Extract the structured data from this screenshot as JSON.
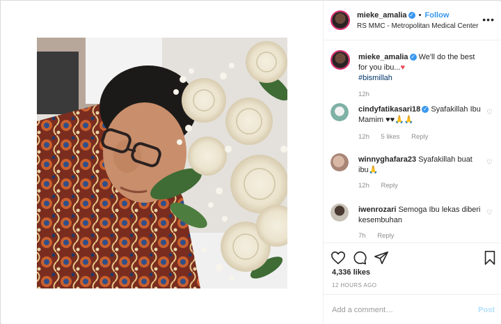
{
  "header": {
    "username": "mieke_amalia",
    "follow_label": "Follow",
    "dot": "•",
    "location": "RS MMC - Metropolitan Medical Center",
    "more_label": "•••"
  },
  "caption": {
    "username": "mieke_amalia",
    "text": "We'll do the best for you ibu...",
    "heart": "♥",
    "hashtag": "#bismillah",
    "time": "12h"
  },
  "comments": [
    {
      "username": "cindyfatikasari18",
      "verified": true,
      "text": "Syafakillah Ibu Mamim ♥♥🙏🙏",
      "time": "12h",
      "likes": "5 likes",
      "reply": "Reply"
    },
    {
      "username": "winnyghafara23",
      "verified": false,
      "text": "Syafakillah buat ibu🙏",
      "time": "12h",
      "likes": "",
      "reply": "Reply"
    },
    {
      "username": "iwenrozari",
      "verified": false,
      "text": "Semoga Ibu lekas diberi kesembuhan",
      "time": "7h",
      "likes": "",
      "reply": "Reply"
    }
  ],
  "footer": {
    "likes": "4,336 likes",
    "time_ago": "12 HOURS AGO",
    "add_comment_placeholder": "Add a comment…",
    "post_label": "Post"
  },
  "icons": [
    "heart-icon",
    "comment-icon",
    "share-icon",
    "bookmark-icon",
    "verified-icon",
    "more-icon"
  ],
  "colors": {
    "link": "#3897f0",
    "verified": "#3897f0",
    "muted": "#8e8e8e",
    "heart": "#ed4956"
  }
}
